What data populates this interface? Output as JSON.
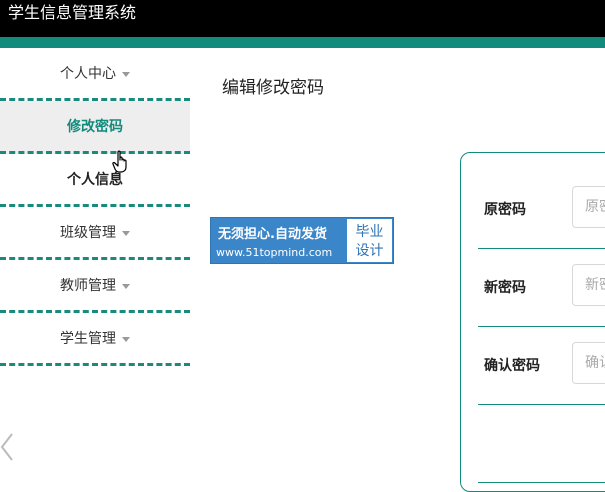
{
  "header": {
    "title": "学生信息管理系统"
  },
  "colors": {
    "accent": "#128b7d",
    "topbar": "#000000",
    "promo_blue": "#3b86c9"
  },
  "sidebar": {
    "items": [
      {
        "label": "个人中心",
        "icon": "chevron-down-icon"
      },
      {
        "label": "修改密码"
      },
      {
        "label": "个人信息"
      },
      {
        "label": "班级管理",
        "icon": "chevron-down-icon"
      },
      {
        "label": "教师管理",
        "icon": "chevron-down-icon"
      },
      {
        "label": "学生管理",
        "icon": "chevron-down-icon"
      }
    ]
  },
  "main": {
    "heading": "编辑修改密码"
  },
  "promo": {
    "line1": "无须担心.自动发货",
    "line2": "www.51topmind.com",
    "badge_line1": "毕业",
    "badge_line2": "设计"
  },
  "form": {
    "fields": [
      {
        "label": "原密码",
        "placeholder": "原密码"
      },
      {
        "label": "新密码",
        "placeholder": "新密码"
      },
      {
        "label": "确认密码",
        "placeholder": "确认密码"
      }
    ]
  }
}
